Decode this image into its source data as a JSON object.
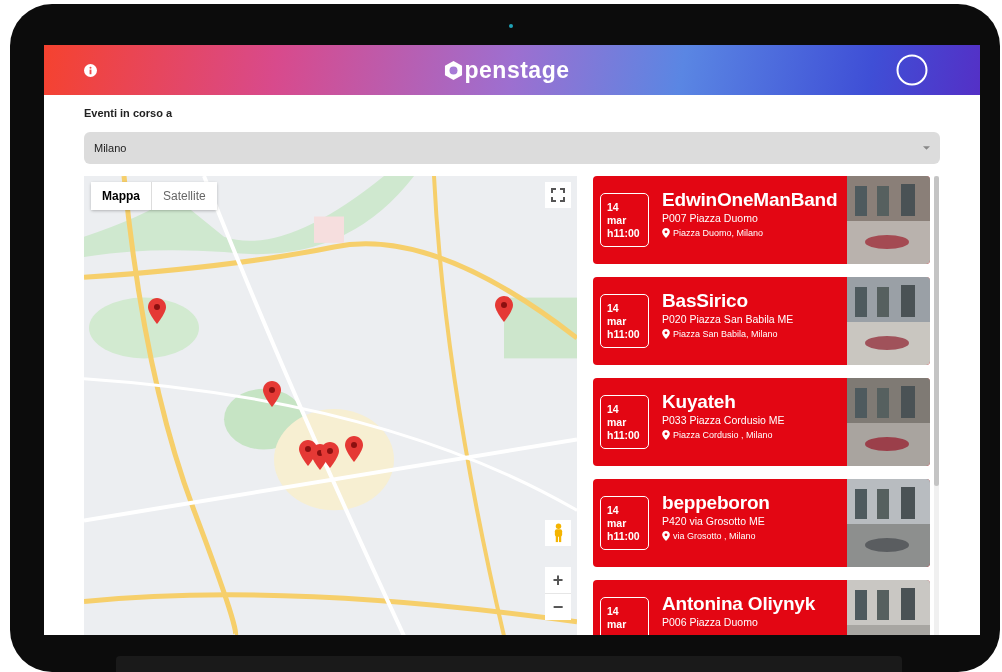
{
  "header": {
    "logo": "penstage"
  },
  "location_label": "Eventi in corso a",
  "location_select": {
    "value": "Milano"
  },
  "map": {
    "tabs": [
      {
        "label": "Mappa",
        "selected": true
      },
      {
        "label": "Satellite",
        "selected": false
      }
    ],
    "zoom_in": "+",
    "zoom_out": "−"
  },
  "events": [
    {
      "day": "14",
      "month": "mar",
      "time": "h11:00",
      "title": "EdwinOneManBand",
      "venue": "P007 Piazza Duomo",
      "address": "Piazza Duomo, Milano"
    },
    {
      "day": "14",
      "month": "mar",
      "time": "h11:00",
      "title": "BasSirico",
      "venue": "P020 Piazza San Babila ME",
      "address": "Piazza San Babila, Milano"
    },
    {
      "day": "14",
      "month": "mar",
      "time": "h11:00",
      "title": "Kuyateh",
      "venue": "P033 Piazza Cordusio ME",
      "address": "Piazza Cordusio , Milano"
    },
    {
      "day": "14",
      "month": "mar",
      "time": "h11:00",
      "title": "beppeboron",
      "venue": "P420 via Grosotto ME",
      "address": "via Grosotto , Milano"
    },
    {
      "day": "14",
      "month": "mar",
      "title": "Antonina Oliynyk",
      "venue": "P006 Piazza Duomo"
    }
  ]
}
